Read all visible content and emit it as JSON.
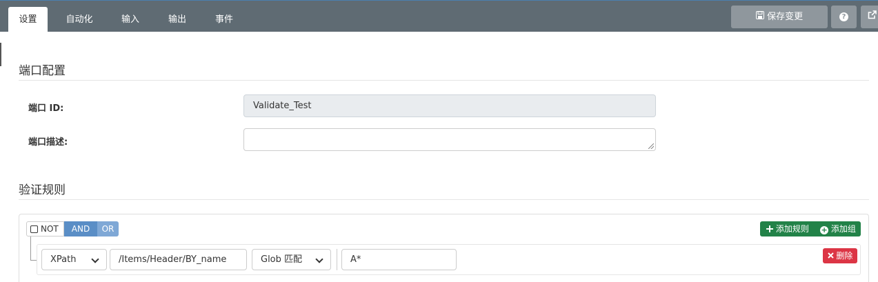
{
  "tabs": [
    {
      "label": "设置",
      "active": true
    },
    {
      "label": "自动化",
      "active": false
    },
    {
      "label": "输入",
      "active": false
    },
    {
      "label": "输出",
      "active": false
    },
    {
      "label": "事件",
      "active": false
    }
  ],
  "toolbar": {
    "save_icon": "floppy-disk-icon",
    "save_label": "保存变更",
    "help_label": "?",
    "help_icon": "question-circle-icon",
    "external_icon": "external-link-icon"
  },
  "port_config": {
    "title": "端口配置",
    "id_label": "端口 ID:",
    "id_value": "Validate_Test",
    "desc_label": "端口描述:",
    "desc_value": ""
  },
  "validation": {
    "title": "验证规则",
    "not_label": "NOT",
    "and_label": "AND",
    "or_label": "OR",
    "add_rule_label": "添加规则",
    "add_group_label": "添加组",
    "rule": {
      "type_value": "XPath",
      "path_value": "/Items/Header/BY_name",
      "operator_value": "Glob 匹配",
      "pattern_value": "A*",
      "delete_label": "删除"
    }
  },
  "colors": {
    "topbar": "#5f6b73",
    "accent_blue": "#5a8ec6",
    "success_green": "#228248",
    "danger_red": "#dc3545"
  }
}
